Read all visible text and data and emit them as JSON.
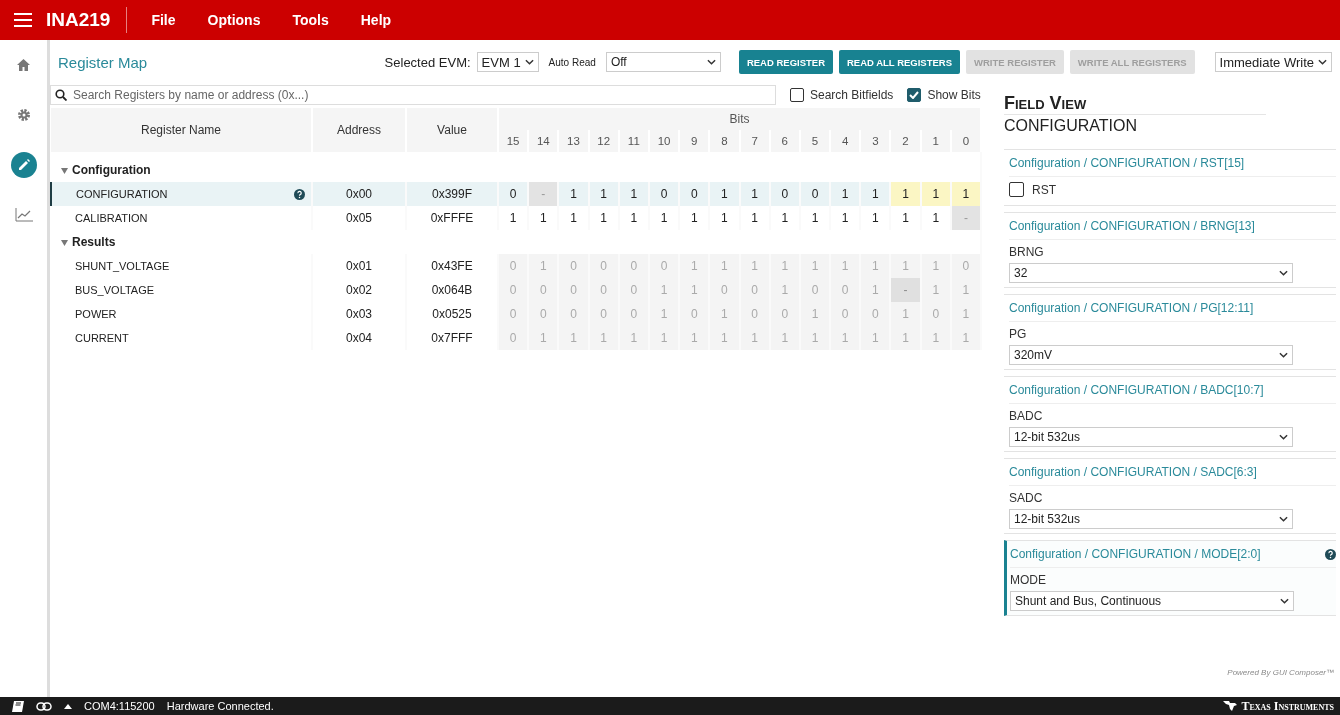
{
  "app_bar": {
    "title": "INA219",
    "menu": [
      "File",
      "Options",
      "Tools",
      "Help"
    ]
  },
  "nav": [
    {
      "kind": "home",
      "selected": false
    },
    {
      "kind": "settings",
      "selected": false
    },
    {
      "kind": "edit",
      "selected": true
    },
    {
      "kind": "chart",
      "selected": false
    }
  ],
  "toolbar": {
    "title": "Register Map",
    "evm_label": "Selected EVM:",
    "evm_value": "EVM 1",
    "auto_read_label": "Auto Read",
    "auto_read_value": "Off",
    "buttons": [
      {
        "label": "READ REGISTER",
        "disabled": false
      },
      {
        "label": "READ ALL REGISTERS",
        "disabled": false
      },
      {
        "label": "WRITE REGISTER",
        "disabled": true
      },
      {
        "label": "WRITE ALL REGISTERS",
        "disabled": true
      }
    ],
    "write_mode": "Immediate Write"
  },
  "search": {
    "placeholder": "Search Registers by name or address (0x...)",
    "options": [
      {
        "label": "Search Bitfields",
        "checked": false
      },
      {
        "label": "Show Bits",
        "checked": true
      }
    ]
  },
  "table": {
    "columns": [
      "Register Name",
      "Address",
      "Value"
    ],
    "bits_label": "Bits",
    "bit_columns": [
      "15",
      "14",
      "13",
      "12",
      "11",
      "10",
      "9",
      "8",
      "7",
      "6",
      "5",
      "4",
      "3",
      "2",
      "1",
      "0"
    ],
    "groups": [
      {
        "name": "Configuration",
        "expanded": true,
        "registers": [
          {
            "name": "CONFIGURATION",
            "address": "0x00",
            "value": "0x399F",
            "selected": true,
            "disabled": false,
            "bits": [
              {
                "value": "0",
                "selected": false,
                "reserved": false
              },
              {
                "value": "-",
                "selected": false,
                "reserved": true
              },
              {
                "value": "1",
                "selected": false,
                "reserved": false
              },
              {
                "value": "1",
                "selected": false,
                "reserved": false
              },
              {
                "value": "1",
                "selected": false,
                "reserved": false
              },
              {
                "value": "0",
                "selected": false,
                "reserved": false
              },
              {
                "value": "0",
                "selected": false,
                "reserved": false
              },
              {
                "value": "1",
                "selected": false,
                "reserved": false
              },
              {
                "value": "1",
                "selected": false,
                "reserved": false
              },
              {
                "value": "0",
                "selected": false,
                "reserved": false
              },
              {
                "value": "0",
                "selected": false,
                "reserved": false
              },
              {
                "value": "1",
                "selected": false,
                "reserved": false
              },
              {
                "value": "1",
                "selected": false,
                "reserved": false
              },
              {
                "value": "1",
                "selected": true,
                "reserved": false
              },
              {
                "value": "1",
                "selected": true,
                "reserved": false
              },
              {
                "value": "1",
                "selected": true,
                "reserved": false
              }
            ]
          },
          {
            "name": "CALIBRATION",
            "address": "0x05",
            "value": "0xFFFE",
            "selected": false,
            "disabled": false,
            "bits": [
              {
                "value": "1",
                "selected": false,
                "reserved": false
              },
              {
                "value": "1",
                "selected": false,
                "reserved": false
              },
              {
                "value": "1",
                "selected": false,
                "reserved": false
              },
              {
                "value": "1",
                "selected": false,
                "reserved": false
              },
              {
                "value": "1",
                "selected": false,
                "reserved": false
              },
              {
                "value": "1",
                "selected": false,
                "reserved": false
              },
              {
                "value": "1",
                "selected": false,
                "reserved": false
              },
              {
                "value": "1",
                "selected": false,
                "reserved": false
              },
              {
                "value": "1",
                "selected": false,
                "reserved": false
              },
              {
                "value": "1",
                "selected": false,
                "reserved": false
              },
              {
                "value": "1",
                "selected": false,
                "reserved": false
              },
              {
                "value": "1",
                "selected": false,
                "reserved": false
              },
              {
                "value": "1",
                "selected": false,
                "reserved": false
              },
              {
                "value": "1",
                "selected": false,
                "reserved": false
              },
              {
                "value": "1",
                "selected": false,
                "reserved": false
              },
              {
                "value": "-",
                "selected": false,
                "reserved": true
              }
            ]
          }
        ]
      },
      {
        "name": "Results",
        "expanded": true,
        "registers": [
          {
            "name": "SHUNT_VOLTAGE",
            "address": "0x01",
            "value": "0x43FE",
            "selected": false,
            "disabled": true,
            "bits": [
              {
                "value": "0",
                "selected": false,
                "reserved": false
              },
              {
                "value": "1",
                "selected": false,
                "reserved": false
              },
              {
                "value": "0",
                "selected": false,
                "reserved": false
              },
              {
                "value": "0",
                "selected": false,
                "reserved": false
              },
              {
                "value": "0",
                "selected": false,
                "reserved": false
              },
              {
                "value": "0",
                "selected": false,
                "reserved": false
              },
              {
                "value": "1",
                "selected": false,
                "reserved": false
              },
              {
                "value": "1",
                "selected": false,
                "reserved": false
              },
              {
                "value": "1",
                "selected": false,
                "reserved": false
              },
              {
                "value": "1",
                "selected": false,
                "reserved": false
              },
              {
                "value": "1",
                "selected": false,
                "reserved": false
              },
              {
                "value": "1",
                "selected": false,
                "reserved": false
              },
              {
                "value": "1",
                "selected": false,
                "reserved": false
              },
              {
                "value": "1",
                "selected": false,
                "reserved": false
              },
              {
                "value": "1",
                "selected": false,
                "reserved": false
              },
              {
                "value": "0",
                "selected": false,
                "reserved": false
              }
            ]
          },
          {
            "name": "BUS_VOLTAGE",
            "address": "0x02",
            "value": "0x064B",
            "selected": false,
            "disabled": true,
            "bits": [
              {
                "value": "0",
                "selected": false,
                "reserved": false
              },
              {
                "value": "0",
                "selected": false,
                "reserved": false
              },
              {
                "value": "0",
                "selected": false,
                "reserved": false
              },
              {
                "value": "0",
                "selected": false,
                "reserved": false
              },
              {
                "value": "0",
                "selected": false,
                "reserved": false
              },
              {
                "value": "1",
                "selected": false,
                "reserved": false
              },
              {
                "value": "1",
                "selected": false,
                "reserved": false
              },
              {
                "value": "0",
                "selected": false,
                "reserved": false
              },
              {
                "value": "0",
                "selected": false,
                "reserved": false
              },
              {
                "value": "1",
                "selected": false,
                "reserved": false
              },
              {
                "value": "0",
                "selected": false,
                "reserved": false
              },
              {
                "value": "0",
                "selected": false,
                "reserved": false
              },
              {
                "value": "1",
                "selected": false,
                "reserved": false
              },
              {
                "value": "-",
                "selected": false,
                "reserved": true
              },
              {
                "value": "1",
                "selected": false,
                "reserved": false
              },
              {
                "value": "1",
                "selected": false,
                "reserved": false
              }
            ]
          },
          {
            "name": "POWER",
            "address": "0x03",
            "value": "0x0525",
            "selected": false,
            "disabled": true,
            "bits": [
              {
                "value": "0",
                "selected": false,
                "reserved": false
              },
              {
                "value": "0",
                "selected": false,
                "reserved": false
              },
              {
                "value": "0",
                "selected": false,
                "reserved": false
              },
              {
                "value": "0",
                "selected": false,
                "reserved": false
              },
              {
                "value": "0",
                "selected": false,
                "reserved": false
              },
              {
                "value": "1",
                "selected": false,
                "reserved": false
              },
              {
                "value": "0",
                "selected": false,
                "reserved": false
              },
              {
                "value": "1",
                "selected": false,
                "reserved": false
              },
              {
                "value": "0",
                "selected": false,
                "reserved": false
              },
              {
                "value": "0",
                "selected": false,
                "reserved": false
              },
              {
                "value": "1",
                "selected": false,
                "reserved": false
              },
              {
                "value": "0",
                "selected": false,
                "reserved": false
              },
              {
                "value": "0",
                "selected": false,
                "reserved": false
              },
              {
                "value": "1",
                "selected": false,
                "reserved": false
              },
              {
                "value": "0",
                "selected": false,
                "reserved": false
              },
              {
                "value": "1",
                "selected": false,
                "reserved": false
              }
            ]
          },
          {
            "name": "CURRENT",
            "address": "0x04",
            "value": "0x7FFF",
            "selected": false,
            "disabled": true,
            "bits": [
              {
                "value": "0",
                "selected": false,
                "reserved": false
              },
              {
                "value": "1",
                "selected": false,
                "reserved": false
              },
              {
                "value": "1",
                "selected": false,
                "reserved": false
              },
              {
                "value": "1",
                "selected": false,
                "reserved": false
              },
              {
                "value": "1",
                "selected": false,
                "reserved": false
              },
              {
                "value": "1",
                "selected": false,
                "reserved": false
              },
              {
                "value": "1",
                "selected": false,
                "reserved": false
              },
              {
                "value": "1",
                "selected": false,
                "reserved": false
              },
              {
                "value": "1",
                "selected": false,
                "reserved": false
              },
              {
                "value": "1",
                "selected": false,
                "reserved": false
              },
              {
                "value": "1",
                "selected": false,
                "reserved": false
              },
              {
                "value": "1",
                "selected": false,
                "reserved": false
              },
              {
                "value": "1",
                "selected": false,
                "reserved": false
              },
              {
                "value": "1",
                "selected": false,
                "reserved": false
              },
              {
                "value": "1",
                "selected": false,
                "reserved": false
              },
              {
                "value": "1",
                "selected": false,
                "reserved": false
              }
            ]
          }
        ]
      }
    ]
  },
  "field_view": {
    "title": "Field View",
    "register": "CONFIGURATION",
    "fields": [
      {
        "kind": "checkbox",
        "path": "Configuration / CONFIGURATION / RST[15]",
        "label": "RST",
        "checked": false,
        "selected": false
      },
      {
        "kind": "select",
        "path": "Configuration / CONFIGURATION / BRNG[13]",
        "label": "BRNG",
        "value": "32",
        "selected": false
      },
      {
        "kind": "select",
        "path": "Configuration / CONFIGURATION / PG[12:11]",
        "label": "PG",
        "value": "320mV",
        "selected": false
      },
      {
        "kind": "select",
        "path": "Configuration / CONFIGURATION / BADC[10:7]",
        "label": "BADC",
        "value": "12-bit 532us",
        "selected": false
      },
      {
        "kind": "select",
        "path": "Configuration / CONFIGURATION / SADC[6:3]",
        "label": "SADC",
        "value": "12-bit 532us",
        "selected": false
      },
      {
        "kind": "select",
        "path": "Configuration / CONFIGURATION / MODE[2:0]",
        "label": "MODE",
        "value": "Shunt and Bus, Continuous",
        "selected": true
      }
    ]
  },
  "status_bar": {
    "port": "COM4:115200",
    "status": "Hardware Connected.",
    "powered_by": "Powered By GUI Composer™",
    "brand": "Texas Instruments"
  }
}
